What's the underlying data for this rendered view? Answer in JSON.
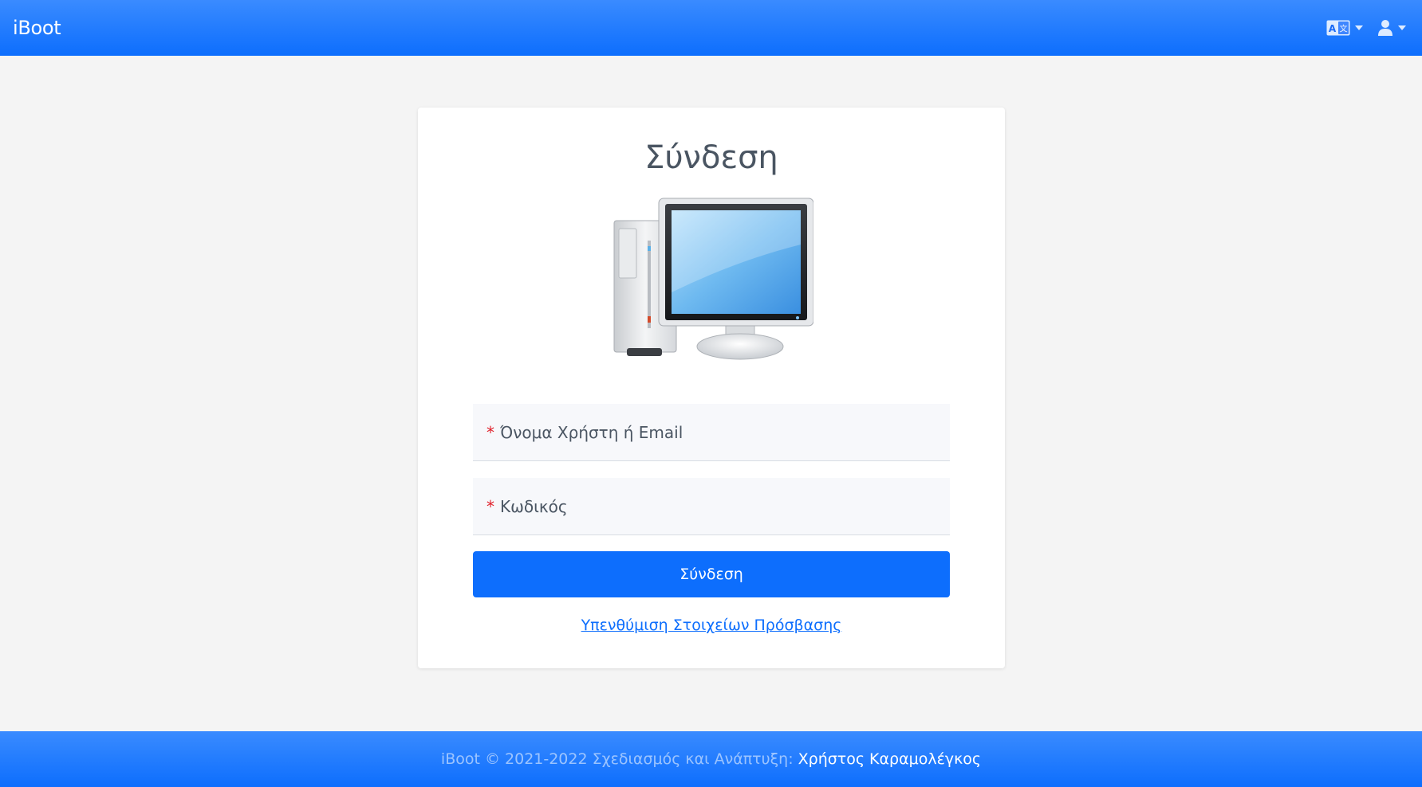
{
  "header": {
    "brand": "iBoot",
    "language_icon": "language-translate-icon",
    "user_icon": "user-icon"
  },
  "login": {
    "title": "Σύνδεση",
    "illustration": "desktop-computer-icon",
    "username_label": "Όνομα Χρήστη ή Email",
    "password_label": "Κωδικός",
    "required_mark": "*",
    "submit_label": "Σύνδεση",
    "remind_link": "Υπενθύμιση Στοιχείων Πρόσβασης"
  },
  "footer": {
    "copyright": "iBoot © 2021-2022 Σχεδιασμός και Ανάπτυξη:",
    "author": "Χρήστος Καραμολέγκος"
  },
  "colors": {
    "accent": "#0d6efd",
    "required": "#e0202a",
    "background": "#f4f4f4"
  }
}
